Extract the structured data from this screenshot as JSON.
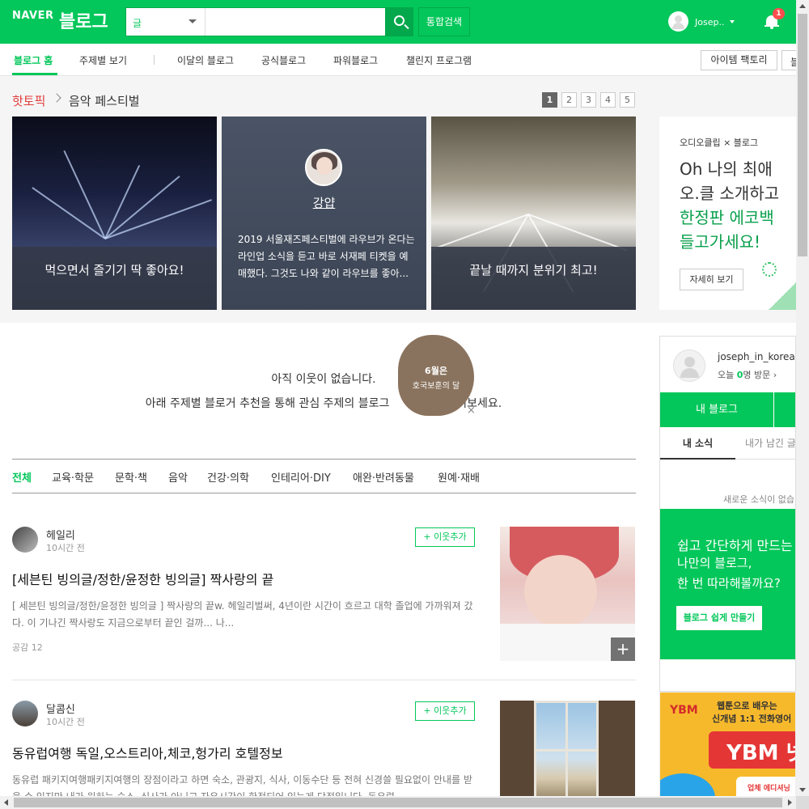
{
  "header": {
    "logo": "NAVER",
    "logo_blog": "블로그",
    "search_type": "글",
    "search_value": "",
    "search_button": "통합검색",
    "user_name": "Josep..",
    "notification_count": "1",
    "colors": {
      "brand": "#03c75a",
      "badge": "#ff4d4d"
    }
  },
  "nav": {
    "items": [
      "블로그 홈",
      "주제별 보기",
      "이달의 블로그",
      "공식블로그",
      "파워블로그",
      "챌린지 프로그램"
    ],
    "item_factory": "아이템 팩토리",
    "extra_button": "블"
  },
  "hot_topic": {
    "label": "핫토픽",
    "topic": "음악 페스티벌",
    "pages": [
      "1",
      "2",
      "3",
      "4",
      "5"
    ],
    "current_page": "1",
    "cards": [
      {
        "caption": "먹으면서 즐기기 딱 좋아요!"
      },
      {
        "name": "강얍",
        "text": "2019 서울재즈페스티벌에 라우브가 온다는 라인업 소식을 듣고 바로 서재페 티켓을 예매했다. 그것도 나와 같이 라우브를 좋아..."
      },
      {
        "caption": "끝날 때까지 분위기 최고!"
      }
    ]
  },
  "ad": {
    "brand": "오디오클립 × 블로그",
    "line1": "Oh 나의 최애",
    "line1b": "오.클 소개하고",
    "line2": "한정판 에코백",
    "line2b": "들고가세요!",
    "more": "자세히 보기"
  },
  "neighbors": {
    "empty_line1": "아직 이웃이 없습니다.",
    "empty_line2": "아래 주제별 블로거 추천을 통해 관심 주제의 블로그",
    "empty_line2_tail": "들어보세요.",
    "float_badge_line1": "6월은",
    "float_badge_line2": "호국보훈의 달",
    "float_close": "×"
  },
  "categories": [
    "전체",
    "교육·학문",
    "문학·책",
    "음악",
    "건강·의학",
    "인테리어·DIY",
    "애완·반려동물",
    "원예·재배"
  ],
  "posts": [
    {
      "author": "헤일리",
      "time": "10시간 전",
      "follow": "+ 이웃추가",
      "title": "[세븐틴 빙의글/정한/윤정한 빙의글] 짝사랑의 끝",
      "desc": "[ 세븐틴 빙의글/정한/윤정한 빙의글 ] 짝사랑의 끝w. 헤일리벌써, 4년이란 시간이 흐르고 대학 졸업에 가까워져 갔다. 이 기나긴 짝사랑도 지금으로부터 끝인 걸까... 나...",
      "likes": "공감 12",
      "plus": "+"
    },
    {
      "author": "달콤신",
      "time": "10시간 전",
      "follow": "+ 이웃추가",
      "title": "동유럽여행 독일,오스트리아,체코,헝가리 호텔정보",
      "desc": "동유럽 패키지여행패키지여행의 장점이라고 하면 숙소, 관광지, 식사, 이동수단 등 전혀 신경쓸 필요없이 안내를 받을 수 있지만 내가 원하는 숙소, 식사가 아니고 자유시간이 한정되어 있는게 단점입니다. 동유럽"
    }
  ],
  "profile": {
    "name": "joseph_in_korea",
    "visit_prefix": "오늘 ",
    "visit_count": "0",
    "visit_suffix": "명 방문 ›",
    "my_blog": "내 블로그",
    "tab_news": "내 소식",
    "tab_left": "내가 남긴 글",
    "no_news": "새로운 소식이 없습니다",
    "promo_l1": "쉽고 간단하게 만드는",
    "promo_l2": "나만의 블로그,",
    "promo_l3": "한 번 따라해볼까요?",
    "promo_button": "블로그 쉽게 만들기"
  },
  "ybm_ad": {
    "logo": "YBM",
    "t1": "웹툰으로 배우는",
    "t2": "신개념 1:1 전화영어",
    "big": "YBM 넷",
    "button": "업체 에디셔닝"
  }
}
